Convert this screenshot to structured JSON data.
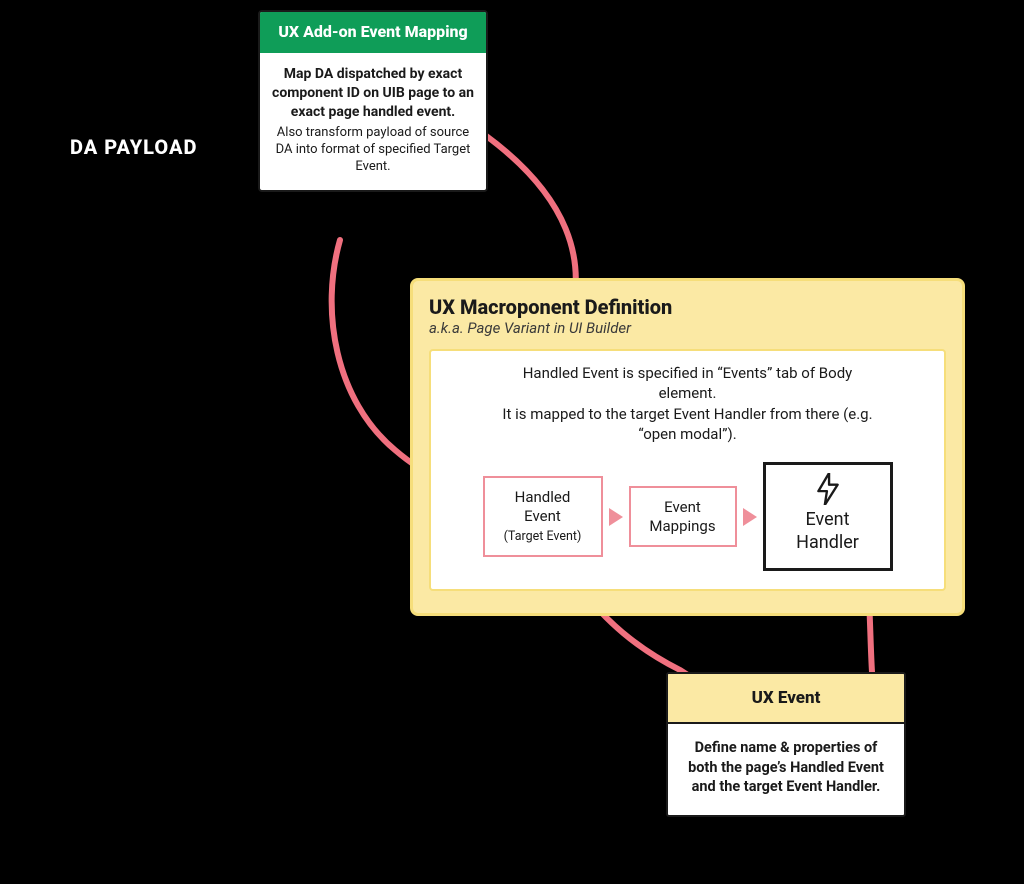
{
  "labels": {
    "da_payload": "DA PAYLOAD"
  },
  "addon_card": {
    "title": "UX Add-on Event Mapping",
    "body_bold": "Map DA dispatched by exact component ID on UIB page to an exact page handled event.",
    "body_sub": "Also transform payload of source DA into format of specified Target Event."
  },
  "macro_card": {
    "title": "UX Macroponent Definition",
    "subtitle": "a.k.a. Page Variant in UI Builder",
    "desc": "Handled Event is specified in “Events” tab of Body element.\nIt is mapped to the target Event Handler from there (e.g. “open modal”).",
    "handled_event": {
      "line1": "Handled",
      "line2": "Event",
      "sub": "(Target Event)"
    },
    "event_mappings": {
      "line1": "Event",
      "line2": "Mappings"
    },
    "event_handler": {
      "line1": "Event",
      "line2": "Handler"
    }
  },
  "ux_event_card": {
    "title": "UX Event",
    "body": "Define name & properties of both the page’s Handled Event and the target Event Handler."
  },
  "colors": {
    "connector": "#f0707f",
    "header_green": "#0f9d58",
    "yellow_bg": "#fbe9a4",
    "yellow_border": "#f6de7a",
    "pink_border": "#ef8f9a"
  }
}
